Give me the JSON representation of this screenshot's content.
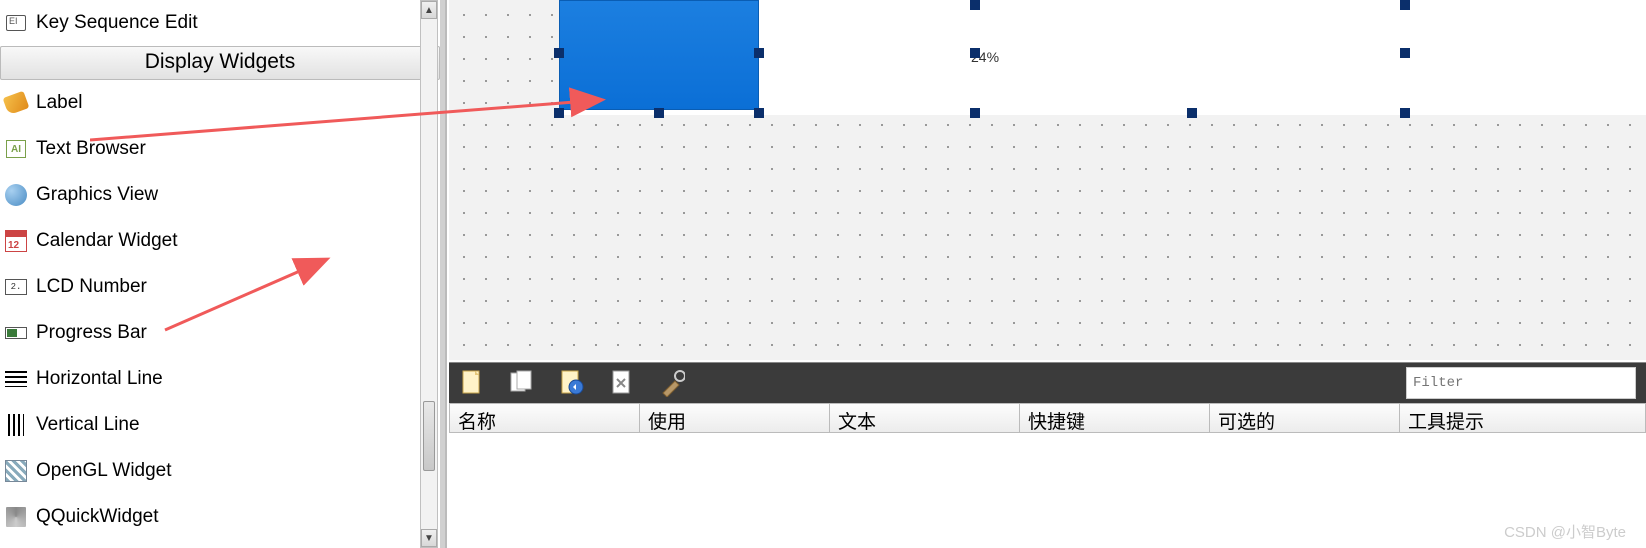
{
  "widget_panel": {
    "top_item": "Key Sequence Edit",
    "category": "Display Widgets",
    "items": [
      "Label",
      "Text Browser",
      "Graphics View",
      "Calendar Widget",
      "LCD Number",
      "Progress Bar",
      "Horizontal Line",
      "Vertical Line",
      "OpenGL Widget",
      "QQuickWidget"
    ]
  },
  "canvas": {
    "progress_text": "24%"
  },
  "bottom": {
    "filter_placeholder": "Filter",
    "columns": {
      "name": "名称",
      "used": "使用",
      "text": "文本",
      "shortcut": "快捷键",
      "checkable": "可选的",
      "tooltip": "工具提示"
    }
  },
  "watermark": "CSDN @小智Byte",
  "icons": {
    "textb_content": "AI",
    "lcd_content": "2."
  }
}
